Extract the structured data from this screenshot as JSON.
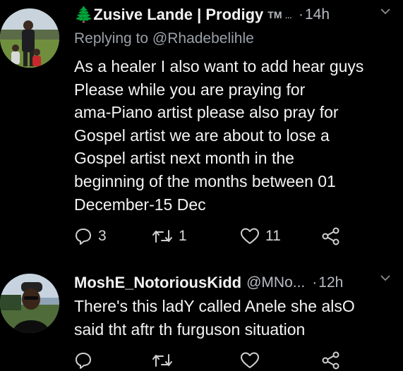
{
  "tweets": [
    {
      "name": "🌲Zusive Lande | Prodigy",
      "tm": "TM",
      "handle_truncation": "...",
      "time": "14h",
      "reply_to_prefix": "Replying to",
      "reply_to_handle": "@Rhadebelihle",
      "text": "As a healer I also want to add hear guys\nPlease while you are praying for\nama-Piano artist please also pray for\nGospel artist we are about to lose a\nGospel artist next month in the\nbeginning of the months between 01\nDecember-15 Dec",
      "replies": "3",
      "retweets": "1",
      "likes": "11"
    },
    {
      "name": "MoshE_NotoriousKidd",
      "handle": "@MNo...",
      "time": "12h",
      "text": "There's this ladY called Anele she alsO\nsaid tht aftr th furguson situation"
    }
  ],
  "separator": "·"
}
